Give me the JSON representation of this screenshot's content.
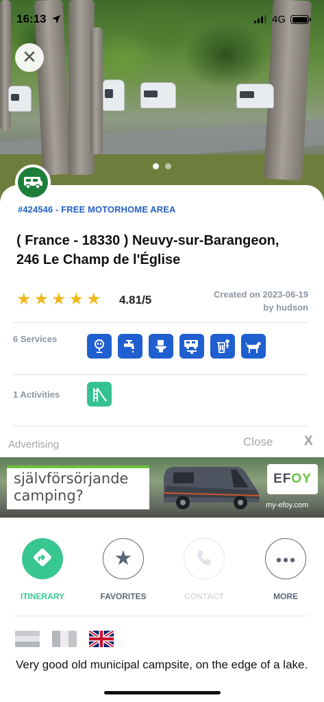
{
  "status_bar": {
    "time": "16:13",
    "network": "4G",
    "location_icon": "location-arrow-icon",
    "battery_level": 1.0
  },
  "photo_carousel": {
    "slide_count": 2,
    "active_index": 0,
    "close_icon": "close-icon"
  },
  "listing": {
    "type_icon": "motorhome-icon",
    "reference": "#424546 - FREE MOTORHOME AREA",
    "address_line1": "( France - 18330 ) Neuvy-sur-Barangeon,",
    "address_line2": "246 Le Champ de l'Église",
    "rating_stars": 5,
    "rating": "4.81/5",
    "created_line1": "Created on 2023-06-19",
    "created_line2": "by hudson"
  },
  "services": {
    "label": "6 Services",
    "icons": [
      "electricity-icon",
      "water-tap-icon",
      "toilet-icon",
      "motorhome-dump-icon",
      "trash-bin-icon",
      "dog-icon"
    ]
  },
  "activities": {
    "label": "1 Activities",
    "icons": [
      "playground-slide-icon"
    ]
  },
  "ad": {
    "label": "Advertising",
    "close": "Close",
    "close_x": "X",
    "headline_line1": "självförsörjande",
    "headline_line2": "camping?",
    "brand_pre": "EF",
    "brand_accent": "OY",
    "url": "my-efoy.com",
    "accent_color": "#6ac13f"
  },
  "actions": [
    {
      "label": "ITINERARY",
      "icon": "directions-icon",
      "color": "#38c691"
    },
    {
      "label": "FAVORITES",
      "icon": "star-icon",
      "color": "#5c6576"
    },
    {
      "label": "CONTACT",
      "icon": "phone-icon",
      "color": "#d9dde2"
    },
    {
      "label": "MORE",
      "icon": "more-dots-icon",
      "color": "#5c6576"
    }
  ],
  "flags": [
    "flag-gray-icon",
    "flag-gray-vertical-icon",
    "flag-uk-icon"
  ],
  "description": "Very good old municipal campsite, on the edge of a lake."
}
